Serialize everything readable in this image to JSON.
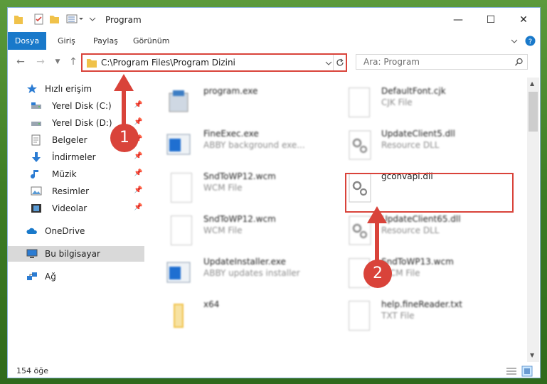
{
  "window": {
    "title": "Program"
  },
  "ribbon": {
    "tabs": [
      "Dosya",
      "Giriş",
      "Paylaş",
      "Görünüm"
    ]
  },
  "address": {
    "path": "C:\\Program Files\\Program Dizini"
  },
  "search": {
    "placeholder": "Ara: Program"
  },
  "nav": {
    "items": [
      {
        "label": "Hızlı erişim",
        "icon": "star-icon"
      },
      {
        "label": "Yerel Disk (C:)",
        "icon": "drive-icon",
        "pinned": true
      },
      {
        "label": "Yerel Disk (D:)",
        "icon": "drive-icon",
        "pinned": true
      },
      {
        "label": "Belgeler",
        "icon": "documents-icon",
        "pinned": true
      },
      {
        "label": "İndirmeler",
        "icon": "download-icon",
        "pinned": true
      },
      {
        "label": "Müzik",
        "icon": "music-icon",
        "pinned": true
      },
      {
        "label": "Resimler",
        "icon": "pictures-icon",
        "pinned": true
      },
      {
        "label": "Videolar",
        "icon": "videos-icon",
        "pinned": true
      },
      {
        "label": "OneDrive",
        "icon": "cloud-icon"
      },
      {
        "label": "Bu bilgisayar",
        "icon": "computer-icon",
        "selected": true
      },
      {
        "label": "Ağ",
        "icon": "network-icon"
      }
    ]
  },
  "files": {
    "left": [
      {
        "name": "program.exe",
        "type": ""
      },
      {
        "name": "FineExec.exe",
        "type": "ABBY background exe..."
      },
      {
        "name": "SndToWP12.wcm",
        "type": "WCM File"
      },
      {
        "name": "SndToWP12.wcm",
        "type": "WCM File"
      },
      {
        "name": "UpdateInstaller.exe",
        "type": "ABBY updates installer"
      },
      {
        "name": "x64",
        "type": ""
      }
    ],
    "right": [
      {
        "name": "DefaultFont.cjk",
        "type": "CJK File"
      },
      {
        "name": "UpdateClient5.dll",
        "type": "Resource DLL"
      },
      {
        "name": "gconvapi.dll",
        "type": ""
      },
      {
        "name": "UpdateClient65.dll",
        "type": "Resource DLL"
      },
      {
        "name": "SndToWP13.wcm",
        "type": "WCM File"
      },
      {
        "name": "help.fineReader.txt",
        "type": "TXT File"
      }
    ]
  },
  "status": {
    "count": "154 öğe"
  },
  "callouts": {
    "one": "1",
    "two": "2"
  },
  "colors": {
    "accent": "#1979ca",
    "highlight": "#d9433a",
    "folder": "#f0c24a"
  }
}
